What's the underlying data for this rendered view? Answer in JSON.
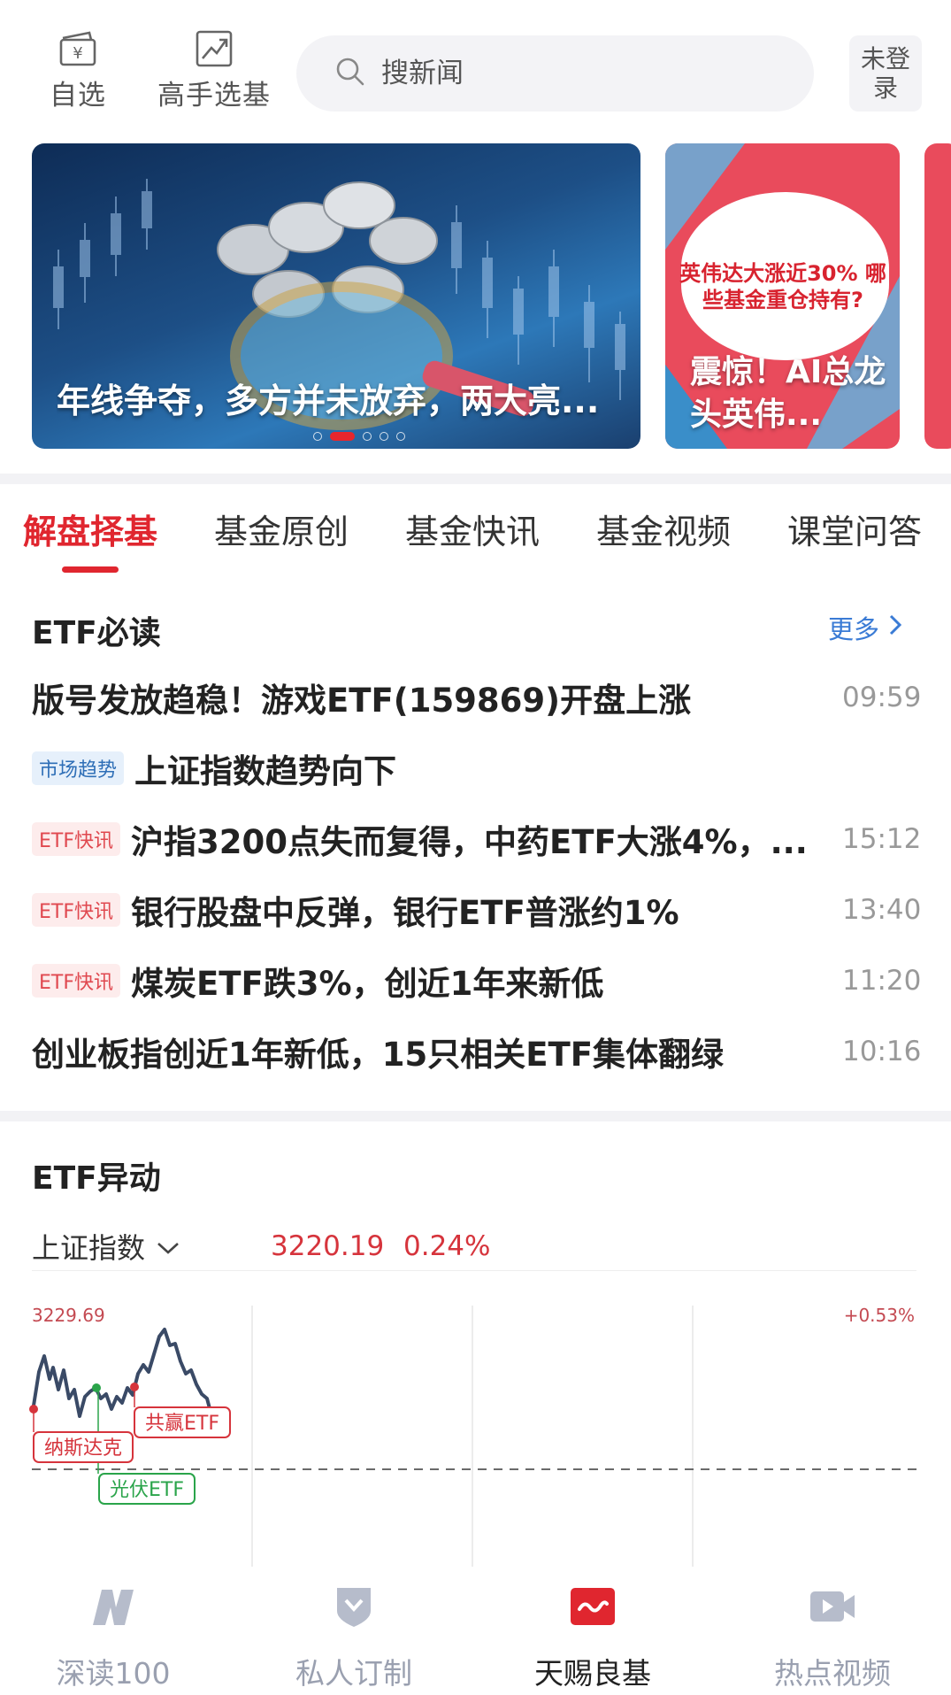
{
  "header": {
    "watchlist_label": "自选",
    "expert_picks_label": "高手选基",
    "search_placeholder": "搜新闻",
    "login_label": "未登录"
  },
  "banner": {
    "slides": [
      {
        "caption": "年线争夺，多方并未放弃，两大亮..."
      },
      {
        "headline": "英伟达大涨近30% 哪些基金重仓持有?",
        "caption": "震惊！AI总龙头英伟..."
      }
    ],
    "dot_count": 5,
    "active_dot": 1
  },
  "tabs": [
    {
      "label": "解盘择基",
      "active": true
    },
    {
      "label": "基金原创",
      "active": false
    },
    {
      "label": "基金快讯",
      "active": false
    },
    {
      "label": "基金视频",
      "active": false
    },
    {
      "label": "课堂问答",
      "active": false
    }
  ],
  "etf_read": {
    "title": "ETF必读",
    "more_label": "更多",
    "items": [
      {
        "tag": "",
        "title": "版号发放趋稳！游戏ETF(159869)开盘上涨",
        "time": "09:59"
      },
      {
        "tag": "市场趋势",
        "title": "上证指数趋势向下",
        "time": ""
      },
      {
        "tag": "ETF快讯",
        "title": "沪指3200点失而复得，中药ETF大涨4%，...",
        "time": "15:12"
      },
      {
        "tag": "ETF快讯",
        "title": "银行股盘中反弹，银行ETF普涨约1%",
        "time": "13:40"
      },
      {
        "tag": "ETF快讯",
        "title": "煤炭ETF跌3%，创近1年来新低",
        "time": "11:20"
      },
      {
        "tag": "",
        "title": "创业板指创近1年新低，15只相关ETF集体翻绿",
        "time": "10:16"
      }
    ]
  },
  "etf_move": {
    "title": "ETF异动",
    "index_name": "上证指数",
    "index_value": "3220.19",
    "index_change": "0.24%",
    "max_label": "3229.69",
    "max_pct_label": "+0.53%",
    "markers": [
      {
        "label": "纳斯达克",
        "color": "#d6343c"
      },
      {
        "label": "光伏ETF",
        "color": "#2aa44a"
      },
      {
        "label": "共赢ETF",
        "color": "#d6343c"
      }
    ]
  },
  "bottom_nav": [
    {
      "label": "深读100",
      "active": false
    },
    {
      "label": "私人订制",
      "active": false
    },
    {
      "label": "天赐良基",
      "active": true
    },
    {
      "label": "热点视频",
      "active": false
    }
  ],
  "colors": {
    "accent_red": "#e0262f",
    "link_blue": "#3a7bd5",
    "up_red": "#d6343c",
    "marker_green": "#2aa44a"
  }
}
